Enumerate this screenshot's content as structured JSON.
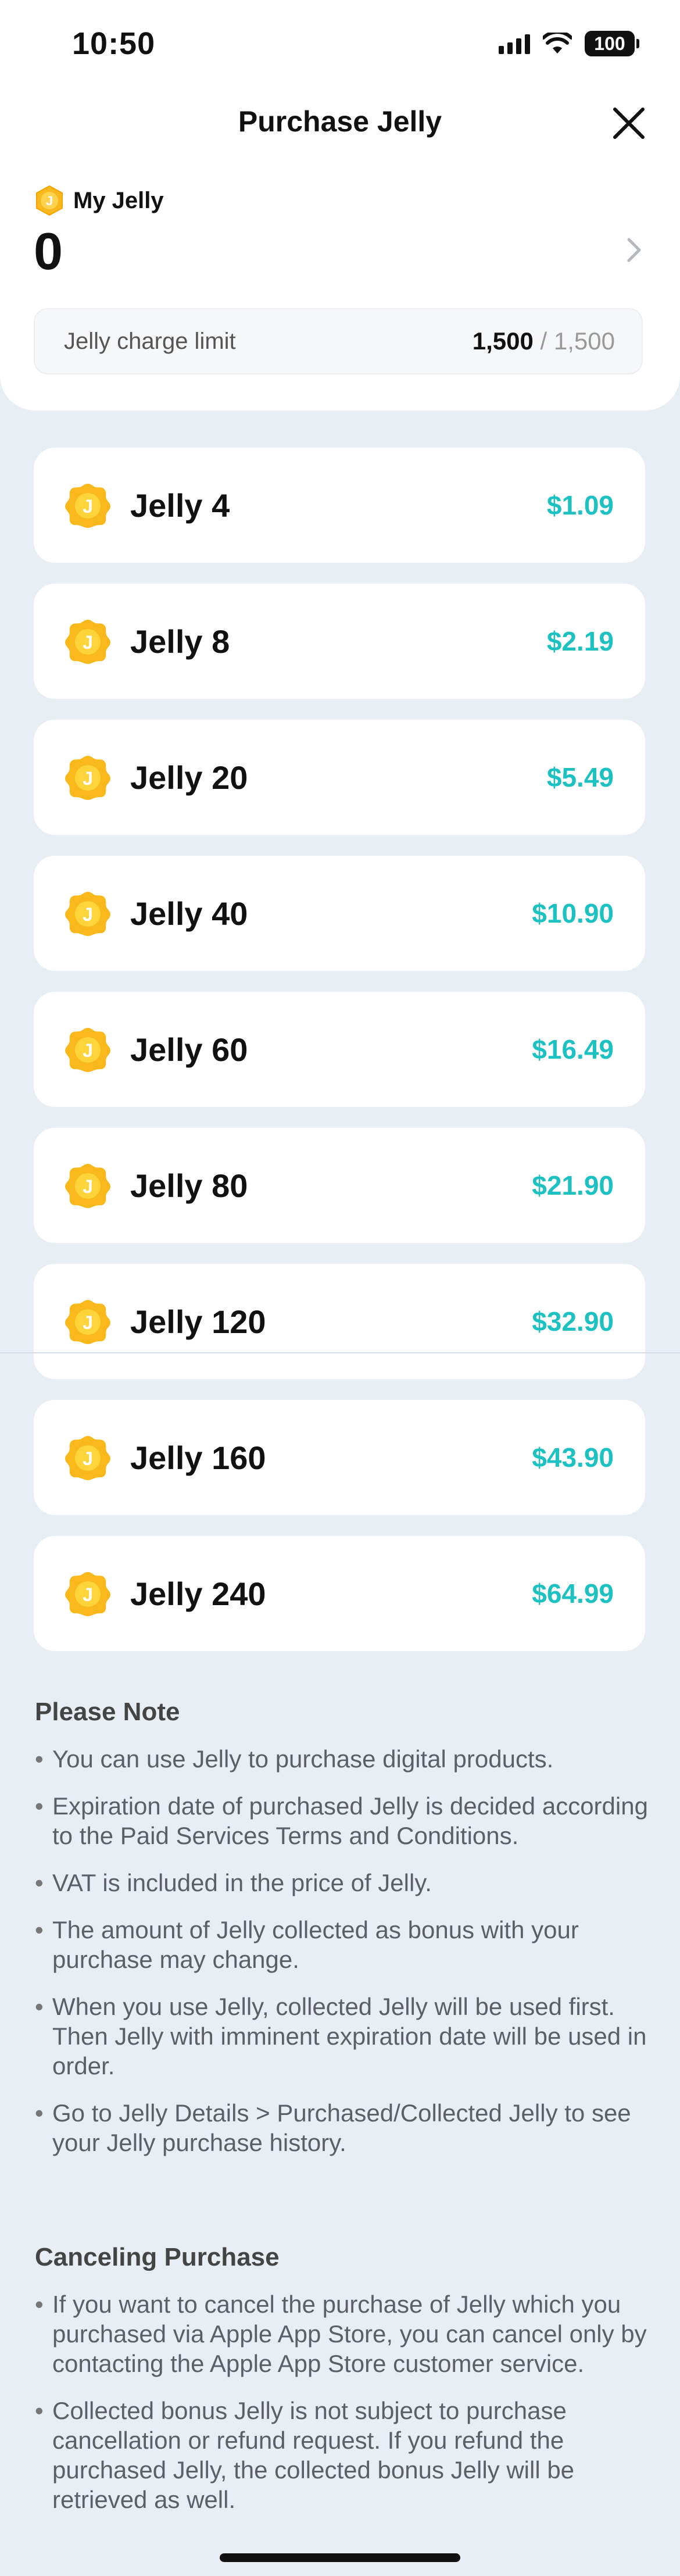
{
  "status_bar": {
    "time": "10:50",
    "battery": "100"
  },
  "header": {
    "title": "Purchase Jelly"
  },
  "wallet": {
    "label": "My Jelly",
    "count": "0",
    "coin_glyph": "J",
    "limit_label": "Jelly charge limit",
    "limit_current": "1,500",
    "limit_max": "/ 1,500"
  },
  "products": [
    {
      "name": "Jelly 4",
      "price": "$1.09"
    },
    {
      "name": "Jelly 8",
      "price": "$2.19"
    },
    {
      "name": "Jelly 20",
      "price": "$5.49"
    },
    {
      "name": "Jelly 40",
      "price": "$10.90"
    },
    {
      "name": "Jelly 60",
      "price": "$16.49"
    },
    {
      "name": "Jelly 80",
      "price": "$21.90"
    },
    {
      "name": "Jelly 120",
      "price": "$32.90"
    },
    {
      "name": "Jelly 160",
      "price": "$43.90"
    },
    {
      "name": "Jelly 240",
      "price": "$64.99"
    }
  ],
  "notes": {
    "title": "Please Note",
    "items": [
      "You can use Jelly to purchase digital products.",
      "Expiration date of purchased Jelly is decided according to the Paid Services Terms and Conditions.",
      "VAT is included in the price of Jelly.",
      "The amount of Jelly collected as bonus with your purchase may change.",
      "When you use Jelly, collected Jelly will be used first. Then Jelly with imminent expiration date will be used in order.",
      "Go to Jelly Details > Purchased/Collected Jelly to see your Jelly purchase history."
    ]
  },
  "cancel": {
    "title": "Canceling Purchase",
    "items": [
      "If you want to cancel the purchase of Jelly which you purchased via Apple App Store, you can cancel only by contacting the Apple App Store customer service.",
      "Collected bonus Jelly is not subject to purchase cancellation or refund request. If you refund the purchased Jelly, the collected bonus Jelly will be retrieved as well."
    ]
  },
  "colors": {
    "price": "#1ec1c1",
    "coin": "#f9b81b",
    "background": "#e9eef5"
  }
}
